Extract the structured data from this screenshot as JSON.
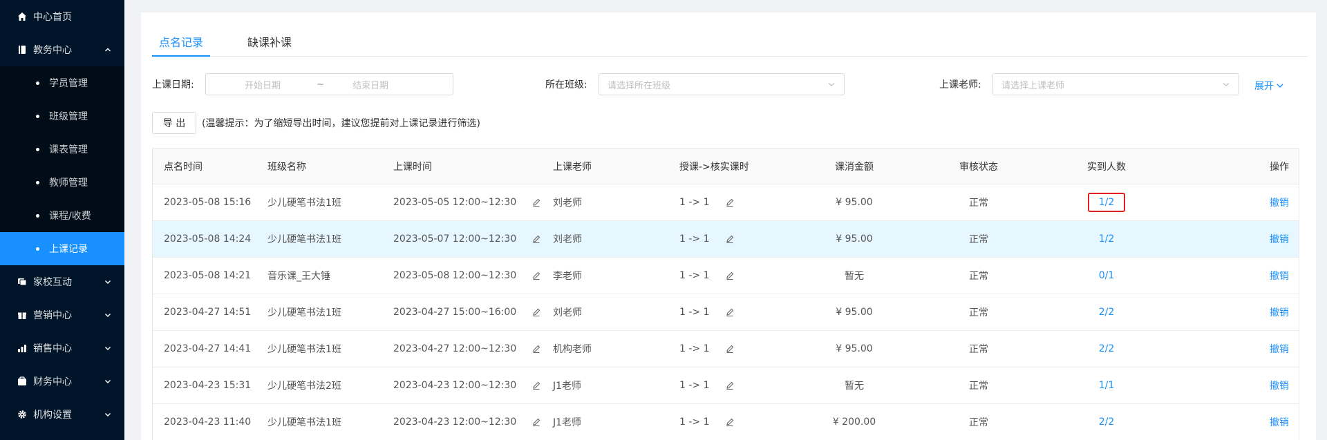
{
  "sidebar": {
    "items": [
      {
        "label": "中心首页",
        "icon": "home-icon"
      },
      {
        "label": "教务中心",
        "icon": "book-icon",
        "expanded": true,
        "children": [
          "学员管理",
          "班级管理",
          "课表管理",
          "教师管理",
          "课程/收费",
          "上课记录"
        ]
      },
      {
        "label": "家校互动",
        "icon": "chat-icon"
      },
      {
        "label": "营销中心",
        "icon": "gift-icon"
      },
      {
        "label": "销售中心",
        "icon": "chart-icon"
      },
      {
        "label": "财务中心",
        "icon": "wallet-icon"
      },
      {
        "label": "机构设置",
        "icon": "gear-icon"
      }
    ],
    "active": "上课记录"
  },
  "tabs": [
    {
      "label": "点名记录",
      "active": true
    },
    {
      "label": "缺课补课",
      "active": false
    }
  ],
  "filters": {
    "date_label": "上课日期:",
    "start_placeholder": "开始日期",
    "date_sep": "~",
    "end_placeholder": "结束日期",
    "class_label": "所在班级:",
    "class_placeholder": "请选择所在班级",
    "teacher_label": "上课老师:",
    "teacher_placeholder": "请选择上课老师",
    "expand": "展开"
  },
  "toolbar": {
    "export_label": "导 出",
    "tip": "(温馨提示：为了缩短导出时间，建议您提前对上课记录进行筛选)"
  },
  "table": {
    "columns": [
      "点名时间",
      "班级名称",
      "上课时间",
      "上课老师",
      "授课->核实课时",
      "课消金额",
      "审核状态",
      "实到人数",
      "操作"
    ],
    "rows": [
      {
        "roll_time": "2023-05-08 15:16",
        "class": "少儿硬笔书法1班",
        "time": "2023-05-05 12:00~12:30",
        "teacher": "刘老师",
        "hours": "1 -> 1",
        "amount": "¥ 95.00",
        "status": "正常",
        "attend": "1/2",
        "action": "撤销"
      },
      {
        "roll_time": "2023-05-08 14:24",
        "class": "少儿硬笔书法1班",
        "time": "2023-05-07 12:00~12:30",
        "teacher": "刘老师",
        "hours": "1 -> 1",
        "amount": "¥ 95.00",
        "status": "正常",
        "attend": "1/2",
        "action": "撤销"
      },
      {
        "roll_time": "2023-05-08 14:21",
        "class": "音乐课_王大锤",
        "time": "2023-05-08 12:00~12:30",
        "teacher": "李老师",
        "hours": "1 -> 1",
        "amount": "暂无",
        "status": "正常",
        "attend": "0/1",
        "action": "撤销"
      },
      {
        "roll_time": "2023-04-27 14:51",
        "class": "少儿硬笔书法1班",
        "time": "2023-04-27 15:00~16:00",
        "teacher": "刘老师",
        "hours": "1 -> 1",
        "amount": "¥ 95.00",
        "status": "正常",
        "attend": "2/2",
        "action": "撤销"
      },
      {
        "roll_time": "2023-04-27 14:41",
        "class": "少儿硬笔书法1班",
        "time": "2023-04-27 12:00~12:30",
        "teacher": "机构老师",
        "hours": "1 -> 1",
        "amount": "¥ 95.00",
        "status": "正常",
        "attend": "2/2",
        "action": "撤销"
      },
      {
        "roll_time": "2023-04-23 15:31",
        "class": "少儿硬笔书法2班",
        "time": "2023-04-23 12:00~12:30",
        "teacher": "J1老师",
        "hours": "1 -> 1",
        "amount": "暂无",
        "status": "正常",
        "attend": "1/1",
        "action": "撤销"
      },
      {
        "roll_time": "2023-04-23 11:40",
        "class": "少儿硬笔书法1班",
        "time": "2023-04-23 12:00~12:30",
        "teacher": "J1老师",
        "hours": "1 -> 1",
        "amount": "¥ 200.00",
        "status": "正常",
        "attend": "2/2",
        "action": "撤销"
      }
    ]
  },
  "colors": {
    "sidebar_bg": "#001529",
    "active": "#1890ff",
    "highlight_row": "#e6f7ff",
    "annotation_box": "#e02020"
  }
}
